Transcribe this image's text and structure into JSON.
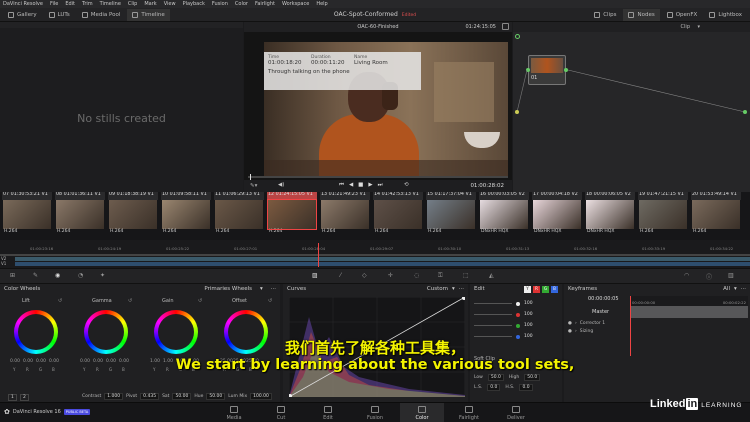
{
  "menu": [
    "DaVinci Resolve",
    "File",
    "Edit",
    "Trim",
    "Timeline",
    "Clip",
    "Mark",
    "View",
    "Playback",
    "Fusion",
    "Color",
    "Fairlight",
    "Workspace",
    "Help"
  ],
  "toolbar": {
    "left": [
      {
        "label": "Gallery",
        "icon": "gallery-icon"
      },
      {
        "label": "LUTs",
        "icon": "luts-icon"
      },
      {
        "label": "Media Pool",
        "icon": "media-pool-icon"
      },
      {
        "label": "Timeline",
        "icon": "timeline-icon"
      }
    ],
    "project_title": "OAC-Spot-Conformed",
    "edited": "Edited",
    "right": [
      {
        "label": "Clips",
        "icon": "clips-icon"
      },
      {
        "label": "Nodes",
        "icon": "nodes-icon"
      },
      {
        "label": "OpenFX",
        "icon": "openfx-icon"
      },
      {
        "label": "Lightbox",
        "icon": "lightbox-icon"
      }
    ]
  },
  "gallery": {
    "empty_text": "No stills created"
  },
  "viewer": {
    "timeline_name": "OAC-60-Finished",
    "timecode_top": "01:24:15:05",
    "info": {
      "time_label": "Time",
      "time": "01:00:18:20",
      "duration_label": "Duration",
      "duration": "00:00:11:20",
      "name_label": "Name",
      "name": "Living Room",
      "note": "Through talking on the phone"
    },
    "timecode": "01:00:28:02"
  },
  "nodes": {
    "header": "Clip",
    "node_label": "01"
  },
  "clips": [
    {
      "num": "07",
      "tc": "01:30:53:21",
      "track": "V1",
      "codec": "H.264",
      "color": "#7a6a5a"
    },
    {
      "num": "08",
      "tc": "01:01:36:11",
      "track": "V1",
      "codec": "H.264",
      "color": "#8a7868"
    },
    {
      "num": "09",
      "tc": "01:18:38:19",
      "track": "V1",
      "codec": "H.264",
      "color": "#6d5c4e"
    },
    {
      "num": "10",
      "tc": "01:09:58:11",
      "track": "V1",
      "codec": "H.264",
      "color": "#9a8670"
    },
    {
      "num": "11",
      "tc": "01:06:29:13",
      "track": "V1",
      "codec": "H.264",
      "color": "#6a5848"
    },
    {
      "num": "12",
      "tc": "01:24:15:05",
      "track": "V1",
      "codec": "H.264",
      "color": "#7c5a40"
    },
    {
      "num": "13",
      "tc": "01:21:49:23",
      "track": "V1",
      "codec": "H.264",
      "color": "#8c7a6a"
    },
    {
      "num": "14",
      "tc": "01:42:53:13",
      "track": "V1",
      "codec": "H.264",
      "color": "#5e5048"
    },
    {
      "num": "15",
      "tc": "01:17:37:04",
      "track": "V1",
      "codec": "H.264",
      "color": "#747e88"
    },
    {
      "num": "16",
      "tc": "00:00:03:05",
      "track": "V2",
      "codec": "DNxHR HQX",
      "color": "#e6dce0"
    },
    {
      "num": "17",
      "tc": "00:00:04:18",
      "track": "V2",
      "codec": "DNxHR HQX",
      "color": "#e8d6da"
    },
    {
      "num": "18",
      "tc": "00:00:06:05",
      "track": "V2",
      "codec": "DNxHR HQX",
      "color": "#ece0e2"
    },
    {
      "num": "19",
      "tc": "01:47:21:15",
      "track": "V1",
      "codec": "H.264",
      "color": "#6e6a62"
    },
    {
      "num": "20",
      "tc": "01:53:49:14",
      "track": "V1",
      "codec": "H.264",
      "color": "#7a6a5c"
    }
  ],
  "mini_timeline": {
    "ticks": [
      "01:00:23:16",
      "01:00:24:19",
      "01:00:25:22",
      "01:00:27:01",
      "01:00:28:04",
      "01:00:29:07",
      "01:00:30:10",
      "01:00:31:13",
      "01:00:32:16",
      "01:00:33:19",
      "01:00:34:22"
    ],
    "tracks": [
      "V2",
      "V1"
    ]
  },
  "color_wheels": {
    "title": "Color Wheels",
    "mode": "Primaries Wheels",
    "wheels": [
      {
        "label": "Lift",
        "values": [
          "0.00",
          "0.00",
          "0.00",
          "0.00"
        ]
      },
      {
        "label": "Gamma",
        "values": [
          "0.00",
          "0.00",
          "0.00",
          "0.00"
        ]
      },
      {
        "label": "Gain",
        "values": [
          "1.00",
          "1.00",
          "1.00",
          "1.00"
        ]
      },
      {
        "label": "Offset",
        "values": [
          "25.00",
          "25.00",
          "25.00"
        ]
      }
    ],
    "channels": [
      "Y",
      "R",
      "G",
      "B"
    ],
    "offset_channels": [
      "R",
      "G",
      "B"
    ],
    "page_nums": [
      "1",
      "2"
    ],
    "bottom": [
      {
        "label": "Contrast",
        "value": "1.000"
      },
      {
        "label": "Pivot",
        "value": "0.435"
      },
      {
        "label": "Sat",
        "value": "50.00"
      },
      {
        "label": "Hue",
        "value": "50.00"
      },
      {
        "label": "Lum Mix",
        "value": "100.00"
      }
    ]
  },
  "curves": {
    "title": "Curves",
    "mode": "Custom"
  },
  "edit": {
    "title": "Edit",
    "channels": [
      "Y",
      "R",
      "G",
      "B"
    ],
    "values": [
      "100",
      "100",
      "100",
      "100"
    ],
    "soft_clip": "Soft Clip",
    "low_label": "Low",
    "low": "50.0",
    "high_label": "High",
    "high": "50.0",
    "ls_label": "L.S.",
    "ls": "0.0",
    "hs_label": "H.S.",
    "hs": "0.0"
  },
  "keyframes": {
    "title": "Keyframes",
    "filter": "All",
    "tc": "00:00:00:05",
    "start": "00:00:00:00",
    "end": "00:00:02:22",
    "master": "Master",
    "rows": [
      "Corrector 1",
      "Sizing"
    ]
  },
  "pages": [
    "Media",
    "Cut",
    "Edit",
    "Fusion",
    "Color",
    "Fairlight",
    "Deliver"
  ],
  "active_page": "Color",
  "brand": {
    "app": "DaVinci Resolve 16",
    "badge": "PUBLIC BETA"
  },
  "subtitles": {
    "zh": "我们首先了解各种工具集，",
    "en": "We start by learning about the various tool sets,"
  },
  "watermark": {
    "linked": "Linked",
    "in": "in",
    "learning": "LEARNING"
  }
}
